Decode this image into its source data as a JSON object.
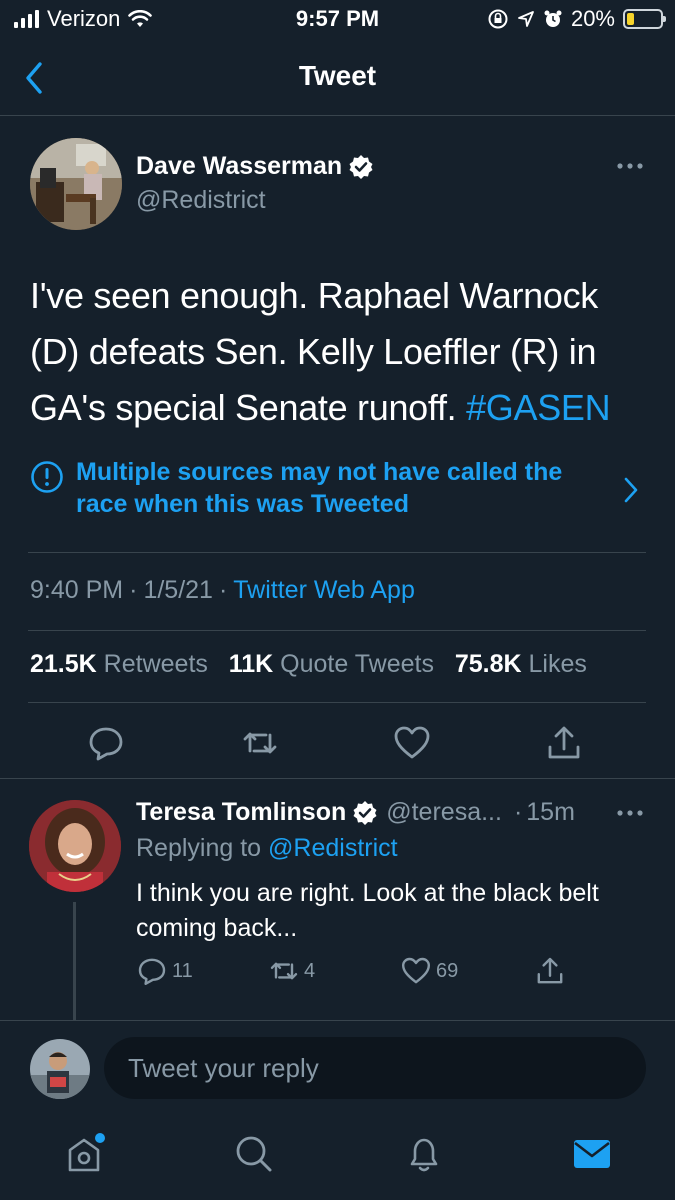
{
  "status_bar": {
    "carrier": "Verizon",
    "time": "9:57 PM",
    "battery": "20%"
  },
  "header": {
    "title": "Tweet"
  },
  "tweet": {
    "author_name": "Dave Wasserman",
    "author_handle": "@Redistrict",
    "text_main": "I've seen enough. Raphael Warnock (D) defeats Sen. Kelly Loeffler (R) in GA's special Senate runoff.",
    "hashtag": "#GASEN",
    "notice": "Multiple sources may not have called the race when this was Tweeted",
    "time": "9:40 PM",
    "date": "1/5/21",
    "source": "Twitter Web App",
    "retweets_count": "21.5K",
    "retweets_label": "Retweets",
    "quotes_count": "11K",
    "quotes_label": "Quote Tweets",
    "likes_count": "75.8K",
    "likes_label": "Likes"
  },
  "reply": {
    "author_name": "Teresa Tomlinson",
    "author_handle": "@teresa...",
    "age": "15m",
    "replying_prefix": "Replying to",
    "replying_handle": "@Redistrict",
    "text": "I think you are right. Look at the black belt coming back...",
    "reply_count": "11",
    "retweet_count": "4",
    "like_count": "69"
  },
  "composer": {
    "placeholder": "Tweet your reply"
  },
  "colors": {
    "background": "#15202b",
    "accent": "#1da1f2",
    "muted": "#8899a6",
    "divider": "#38444d"
  },
  "icons": [
    "signal-icon",
    "wifi-icon",
    "rotation-lock-icon",
    "location-icon",
    "alarm-icon",
    "battery-icon",
    "back-chevron-icon",
    "verified-badge-icon",
    "more-icon",
    "info-icon",
    "chevron-right-icon",
    "reply-icon",
    "retweet-icon",
    "like-icon",
    "share-icon",
    "home-icon",
    "search-icon",
    "notifications-icon",
    "messages-icon"
  ]
}
